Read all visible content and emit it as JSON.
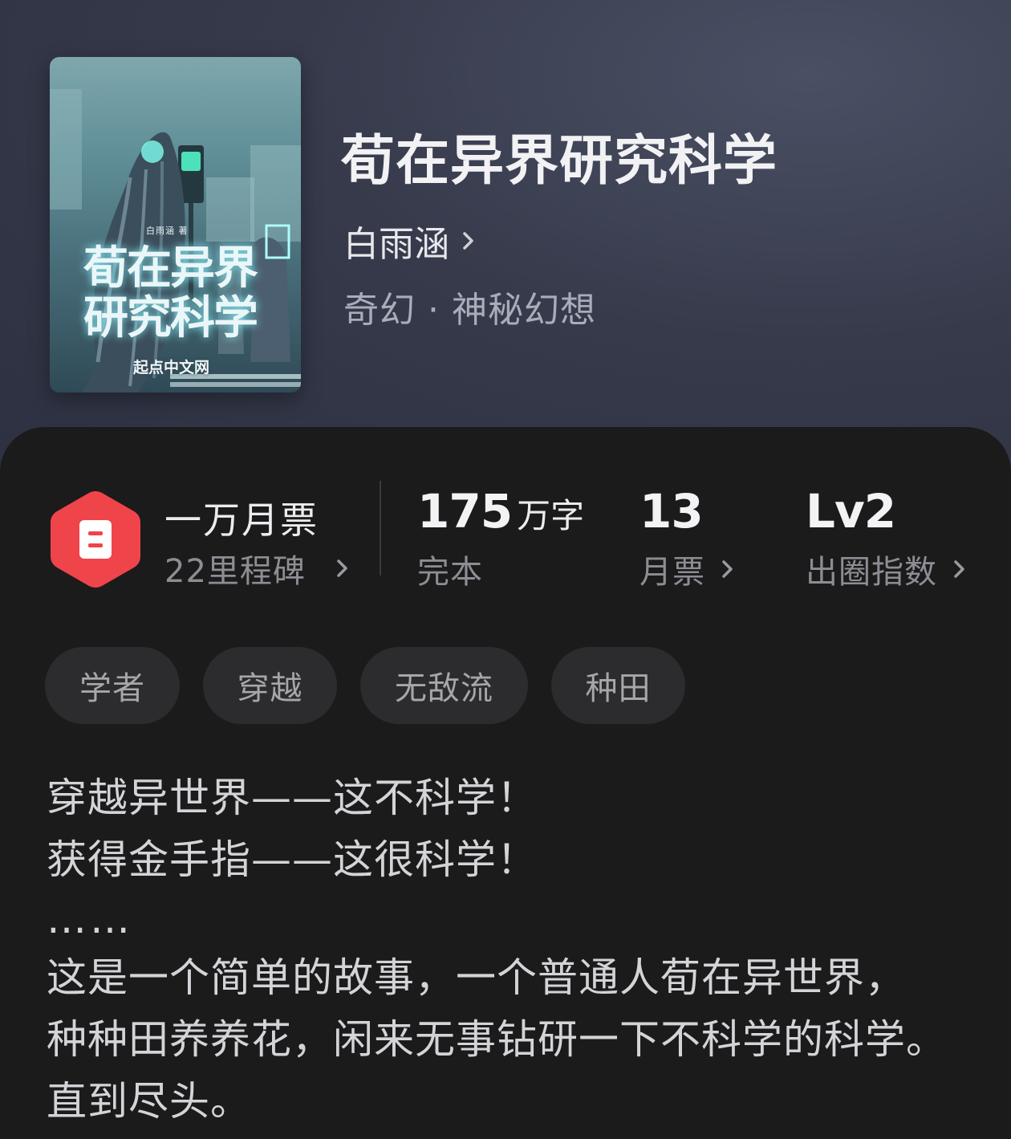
{
  "book": {
    "cover": {
      "title": "荀在异界研究科学",
      "author": "白雨涵 著",
      "brand": "起点中文网"
    },
    "title": "荀在异界研究科学",
    "author": "白雨涵",
    "genre": "奇幻 · 神秘幻想"
  },
  "milestone": {
    "title": "一万月票",
    "subtitle": "22里程碑",
    "badge_color": "#f0444b"
  },
  "stats": [
    {
      "value": "175",
      "unit": "万字",
      "label": "完本"
    },
    {
      "value": "13",
      "unit": "",
      "label": "月票"
    },
    {
      "value": "Lv2",
      "unit": "",
      "label": "出圈指数"
    }
  ],
  "tags": [
    "学者",
    "穿越",
    "无敌流",
    "种田"
  ],
  "description": [
    "穿越异世界——这不科学！",
    "获得金手指——这很科学！",
    "……",
    "这是一个简单的故事，一个普通人荀在异世界，",
    "种种田养养花，闲来无事钻研一下不科学的科学。",
    "直到尽头。"
  ],
  "colors": {
    "header_bg": "#363a4b",
    "panel_bg": "#1b1b1c",
    "tag_bg": "#2c2c2e",
    "accent": "#f0444b"
  }
}
